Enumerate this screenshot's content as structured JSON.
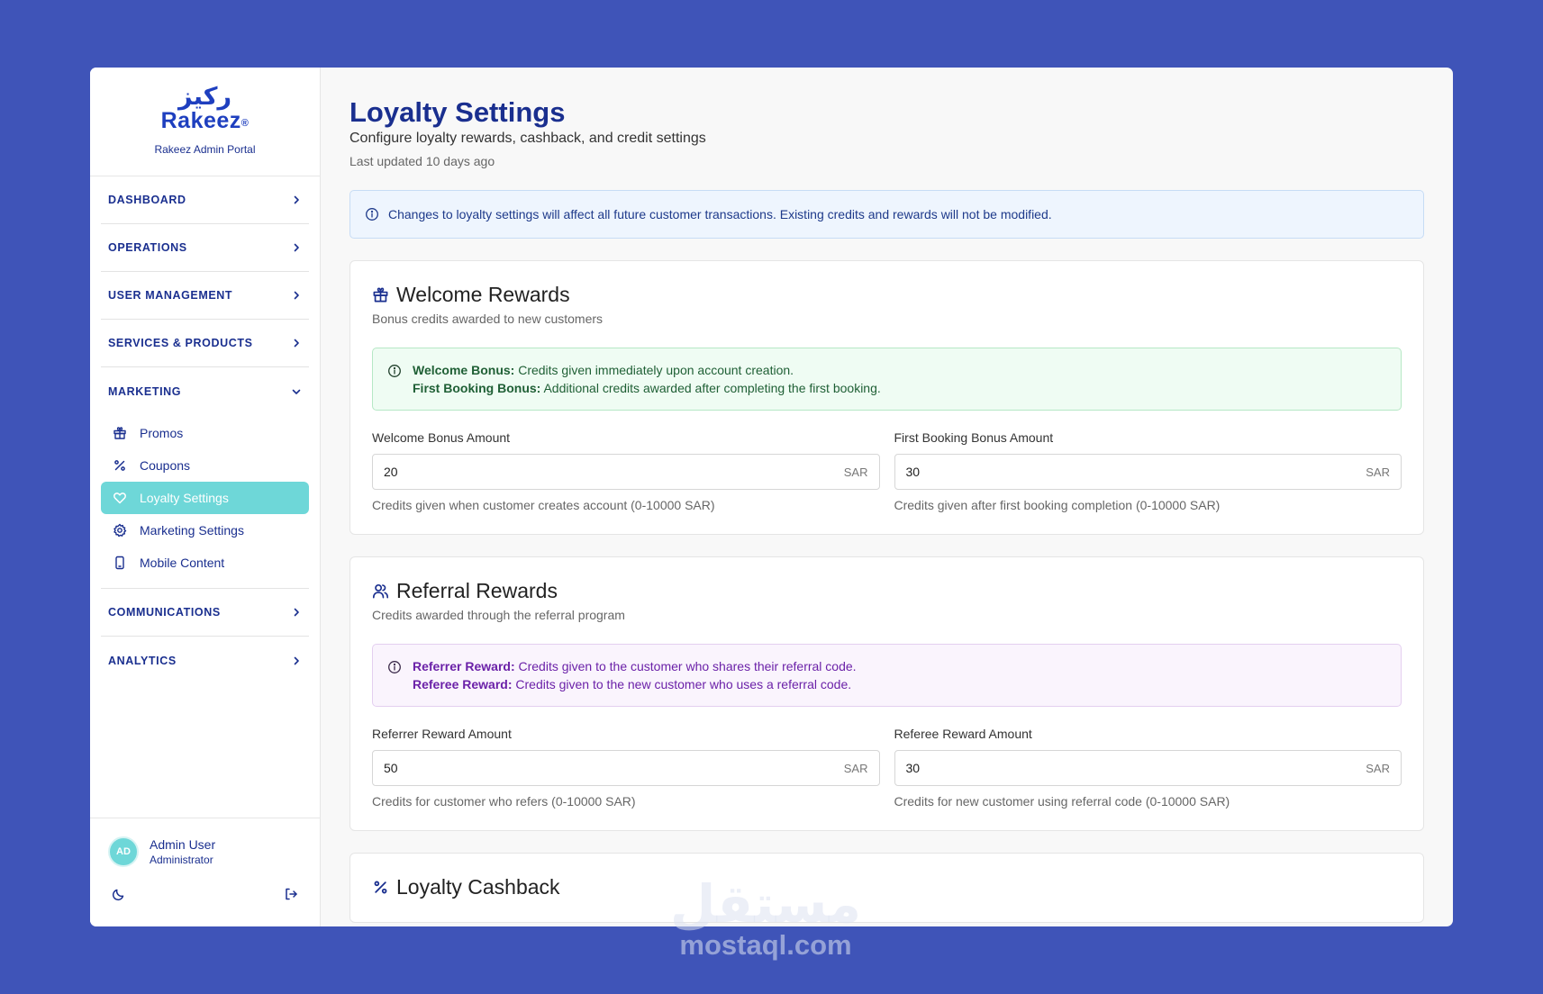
{
  "brand": {
    "arabic": "ركيز",
    "latin": "Rakeez",
    "reg": "®",
    "subtitle": "Rakeez Admin Portal"
  },
  "sidebar": {
    "sections_top": [
      {
        "label": "DASHBOARD"
      },
      {
        "label": "OPERATIONS"
      },
      {
        "label": "USER MANAGEMENT"
      },
      {
        "label": "SERVICES & PRODUCTS"
      }
    ],
    "marketing": {
      "label": "MARKETING",
      "items": [
        {
          "label": "Promos",
          "icon": "gift-icon"
        },
        {
          "label": "Coupons",
          "icon": "percent-icon"
        },
        {
          "label": "Loyalty Settings",
          "icon": "heart-icon",
          "active": true
        },
        {
          "label": "Marketing Settings",
          "icon": "gear-icon"
        },
        {
          "label": "Mobile Content",
          "icon": "smartphone-icon"
        }
      ]
    },
    "sections_bottom": [
      {
        "label": "COMMUNICATIONS"
      },
      {
        "label": "ANALYTICS"
      }
    ]
  },
  "user": {
    "initials": "AD",
    "name": "Admin User",
    "role": "Administrator"
  },
  "page": {
    "title": "Loyalty Settings",
    "subtitle": "Configure loyalty rewards, cashback, and credit settings",
    "updated": "Last updated 10 days ago",
    "banner": "Changes to loyalty settings will affect all future customer transactions. Existing credits and rewards will not be modified."
  },
  "welcome": {
    "title": "Welcome Rewards",
    "desc": "Bonus credits awarded to new customers",
    "note_line1_bold": "Welcome Bonus:",
    "note_line1_text": " Credits given immediately upon account creation.",
    "note_line2_bold": "First Booking Bonus:",
    "note_line2_text": " Additional credits awarded after completing the first booking.",
    "field1": {
      "label": "Welcome Bonus Amount",
      "value": "20",
      "suffix": "SAR",
      "help": "Credits given when customer creates account (0-10000 SAR)"
    },
    "field2": {
      "label": "First Booking Bonus Amount",
      "value": "30",
      "suffix": "SAR",
      "help": "Credits given after first booking completion (0-10000 SAR)"
    }
  },
  "referral": {
    "title": "Referral Rewards",
    "desc": "Credits awarded through the referral program",
    "note_line1_bold": "Referrer Reward:",
    "note_line1_text": " Credits given to the customer who shares their referral code.",
    "note_line2_bold": "Referee Reward:",
    "note_line2_text": " Credits given to the new customer who uses a referral code.",
    "field1": {
      "label": "Referrer Reward Amount",
      "value": "50",
      "suffix": "SAR",
      "help": "Credits for customer who refers (0-10000 SAR)"
    },
    "field2": {
      "label": "Referee Reward Amount",
      "value": "30",
      "suffix": "SAR",
      "help": "Credits for new customer using referral code (0-10000 SAR)"
    }
  },
  "cashback": {
    "title": "Loyalty Cashback"
  },
  "watermark": {
    "arabic": "مستقل",
    "latin": "mostaql.com"
  },
  "colors": {
    "background": "#3f54b8",
    "primary": "#1a2f8f",
    "active": "#6ed7d8"
  }
}
